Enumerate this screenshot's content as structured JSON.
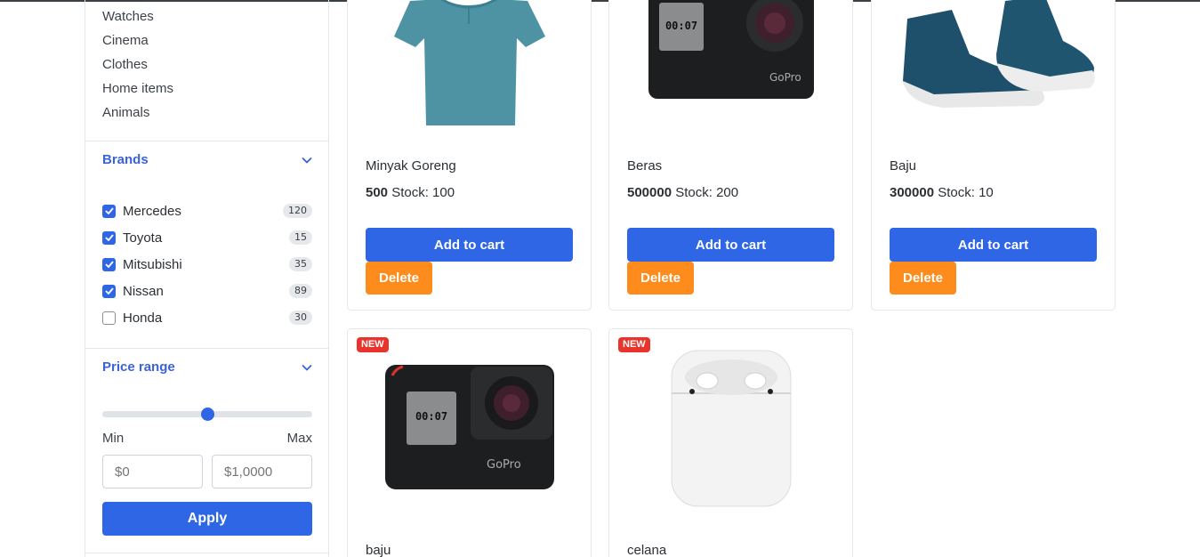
{
  "categories": [
    "Watches",
    "Cinema",
    "Clothes",
    "Home items",
    "Animals"
  ],
  "brands": {
    "title": "Brands",
    "items": [
      {
        "label": "Mercedes",
        "count": "120",
        "checked": true
      },
      {
        "label": "Toyota",
        "count": "15",
        "checked": true
      },
      {
        "label": "Mitsubishi",
        "count": "35",
        "checked": true
      },
      {
        "label": "Nissan",
        "count": "89",
        "checked": true
      },
      {
        "label": "Honda",
        "count": "30",
        "checked": false
      }
    ]
  },
  "price_range": {
    "title": "Price range",
    "slider_value": 0.5,
    "min_label": "Min",
    "max_label": "Max",
    "min_placeholder": "$0",
    "max_placeholder": "$1,0000",
    "apply_label": "Apply"
  },
  "products": [
    {
      "name": "Minyak Goreng",
      "price": "500",
      "stock": "Stock: 100",
      "image": "teal-tshirt",
      "is_new": false,
      "cart_label": "Add to cart",
      "delete_label": "Delete"
    },
    {
      "name": "Beras",
      "price": "500000",
      "stock": "Stock: 200",
      "image": "gopro-camera",
      "is_new": false,
      "cart_label": "Add to cart",
      "delete_label": "Delete"
    },
    {
      "name": "Baju",
      "price": "300000",
      "stock": "Stock: 10",
      "image": "blue-sneakers",
      "is_new": false,
      "cart_label": "Add to cart",
      "delete_label": "Delete"
    },
    {
      "name": "baju",
      "image": "gopro-camera",
      "is_new": true,
      "badge": "NEW"
    },
    {
      "name": "celana",
      "image": "airpods-case",
      "is_new": true,
      "badge": "NEW"
    }
  ],
  "colors": {
    "primary": "#2f66e6",
    "danger_orange": "#fd8c1c",
    "new_badge": "#e8342c",
    "section_title": "#3b63d9"
  }
}
